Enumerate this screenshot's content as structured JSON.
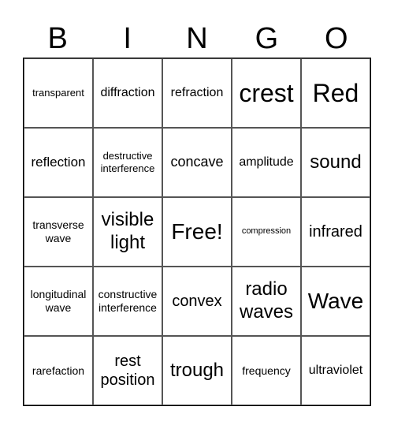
{
  "header": [
    "B",
    "I",
    "N",
    "G",
    "O"
  ],
  "cells": [
    [
      "transparent",
      "diffraction",
      "refraction",
      "crest",
      "Red"
    ],
    [
      "reflection",
      "destructive interference",
      "concave",
      "amplitude",
      "sound"
    ],
    [
      "transverse wave",
      "visible light",
      "Free!",
      "compression",
      "infrared"
    ],
    [
      "longitudinal wave",
      "constructive interference",
      "convex",
      "radio waves",
      "Wave"
    ],
    [
      "rarefaction",
      "rest position",
      "trough",
      "frequency",
      "ultraviolet"
    ]
  ]
}
